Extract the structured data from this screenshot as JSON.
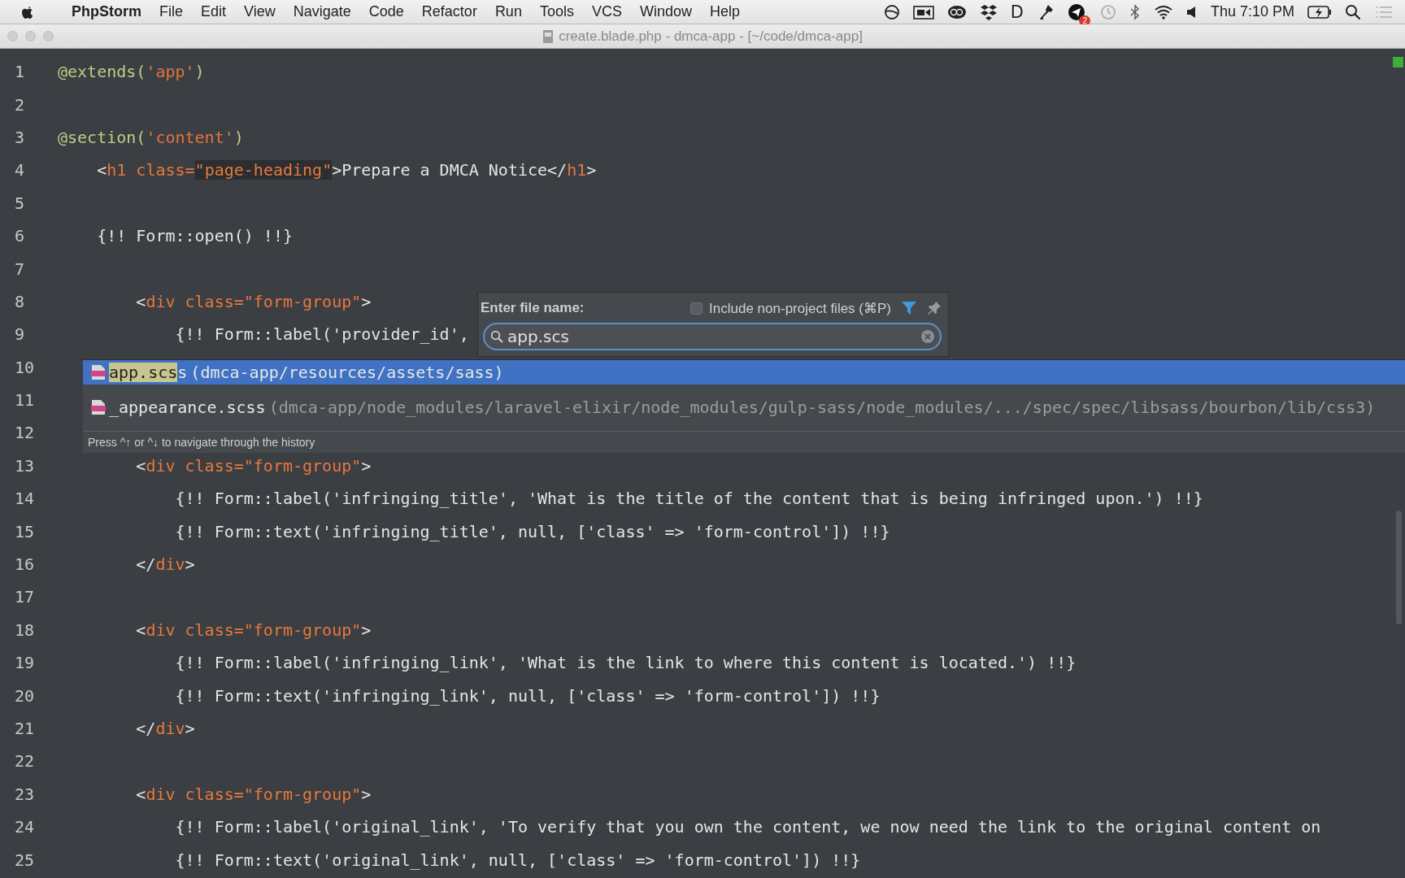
{
  "menu_bar": {
    "app_name": "PhpStorm",
    "menus": [
      "File",
      "Edit",
      "View",
      "Navigate",
      "Code",
      "Refactor",
      "Run",
      "Tools",
      "VCS",
      "Window",
      "Help"
    ],
    "glyph": "D",
    "badge": "2",
    "clock": "Thu 7:10 PM"
  },
  "window": {
    "title": "create.blade.php - dmca-app - [~/code/dmca-app]"
  },
  "editor": {
    "lines": [
      {
        "number": "1",
        "segments": [
          {
            "kind": "directive",
            "text": "@extends("
          },
          {
            "kind": "string",
            "text": "'app'"
          },
          {
            "kind": "directive",
            "text": ")"
          }
        ]
      },
      {
        "number": "2"
      },
      {
        "number": "3",
        "segments": [
          {
            "kind": "directive",
            "text": "@section("
          },
          {
            "kind": "string",
            "text": "'content'"
          },
          {
            "kind": "directive",
            "text": ")"
          }
        ]
      },
      {
        "number": "4",
        "segments": [
          {
            "kind": "text",
            "text": "    <"
          },
          {
            "kind": "tag",
            "text": "h1 class="
          },
          {
            "kind": "highlight",
            "text": "\"page-heading\""
          },
          {
            "kind": "text",
            "text": ">Prepare a DMCA Notice</"
          },
          {
            "kind": "tag",
            "text": "h1"
          },
          {
            "kind": "text",
            "text": ">"
          }
        ]
      },
      {
        "number": "5"
      },
      {
        "number": "6",
        "segments": [
          {
            "kind": "text",
            "text": "    {!! Form::open() !!}"
          }
        ]
      },
      {
        "number": "7"
      },
      {
        "number": "8",
        "segments": [
          {
            "kind": "text",
            "text": "        <"
          },
          {
            "kind": "tag",
            "text": "div class=\"form-group\""
          },
          {
            "kind": "text",
            "text": ">"
          }
        ]
      },
      {
        "number": "9",
        "segments": [
          {
            "kind": "text",
            "text": "            {!! Form::label('provider_id',"
          }
        ]
      },
      {
        "number": "10"
      },
      {
        "number": "11"
      },
      {
        "number": "12"
      },
      {
        "number": "13",
        "segments": [
          {
            "kind": "text",
            "text": "        <"
          },
          {
            "kind": "tag",
            "text": "div class=\"form-group\""
          },
          {
            "kind": "text",
            "text": ">"
          }
        ]
      },
      {
        "number": "14",
        "segments": [
          {
            "kind": "text",
            "text": "            {!! Form::label('infringing_title', 'What is the title of the content that is being infringed upon.') !!}"
          }
        ]
      },
      {
        "number": "15",
        "segments": [
          {
            "kind": "text",
            "text": "            {!! Form::text('infringing_title', null, ['class' => 'form-control']) !!}"
          }
        ]
      },
      {
        "number": "16",
        "segments": [
          {
            "kind": "text",
            "text": "        </"
          },
          {
            "kind": "tag",
            "text": "div"
          },
          {
            "kind": "text",
            "text": ">"
          }
        ]
      },
      {
        "number": "17"
      },
      {
        "number": "18",
        "segments": [
          {
            "kind": "text",
            "text": "        <"
          },
          {
            "kind": "tag",
            "text": "div class=\"form-group\""
          },
          {
            "kind": "text",
            "text": ">"
          }
        ]
      },
      {
        "number": "19",
        "segments": [
          {
            "kind": "text",
            "text": "            {!! Form::label('infringing_link', 'What is the link to where this content is located.') !!}"
          }
        ]
      },
      {
        "number": "20",
        "segments": [
          {
            "kind": "text",
            "text": "            {!! Form::text('infringing_link', null, ['class' => 'form-control']) !!}"
          }
        ]
      },
      {
        "number": "21",
        "segments": [
          {
            "kind": "text",
            "text": "        </"
          },
          {
            "kind": "tag",
            "text": "div"
          },
          {
            "kind": "text",
            "text": ">"
          }
        ]
      },
      {
        "number": "22"
      },
      {
        "number": "23",
        "segments": [
          {
            "kind": "text",
            "text": "        <"
          },
          {
            "kind": "tag",
            "text": "div class=\"form-group\""
          },
          {
            "kind": "text",
            "text": ">"
          }
        ]
      },
      {
        "number": "24",
        "segments": [
          {
            "kind": "text",
            "text": "            {!! Form::label('original_link', 'To verify that you own the content, we now need the link to the original content on"
          }
        ]
      },
      {
        "number": "25",
        "segments": [
          {
            "kind": "text",
            "text": "            {!! Form::text('original_link', null, ['class' => 'form-control']) !!}"
          }
        ]
      }
    ]
  },
  "goto_file": {
    "label": "Enter file name:",
    "option": {
      "label": "Include non-project files (⌘P)",
      "checked": false
    },
    "query": "app.scs",
    "results": [
      {
        "match": "app.scs",
        "name": "s",
        "path": "(dmca-app/resources/assets/sass)",
        "selected": true
      },
      {
        "name": "_appearance.scss",
        "path": "(dmca-app/node_modules/laravel-elixir/node_modules/gulp-sass/node_modules/.../spec/spec/libsass/bourbon/lib/css3)",
        "selected": false
      }
    ],
    "hint": "Press ^↑ or ^↓ to navigate through the history"
  }
}
